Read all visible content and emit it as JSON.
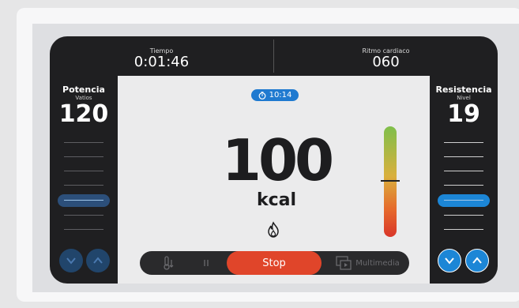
{
  "top": {
    "time_label": "Tiempo",
    "time_value": "0:01:46",
    "hr_label": "Ritmo cardiaco",
    "hr_value": "060"
  },
  "left_panel": {
    "title": "Potencia",
    "subtitle": "Vatios",
    "value": "120"
  },
  "right_panel": {
    "title": "Resistencia",
    "subtitle": "Nivel",
    "value": "19"
  },
  "center": {
    "timer": "10:14",
    "calories": "100",
    "unit": "kcal"
  },
  "bottom": {
    "stop_label": "Stop",
    "multimedia_label": "Multimedia"
  },
  "colors": {
    "accent_blue": "#1c86d6",
    "stop_red": "#e0452a",
    "dark": "#1f1f21"
  },
  "icons": [
    "timer-icon",
    "flame-icon",
    "temperature-icon",
    "pause-icon",
    "multimedia-icon",
    "chevron-down-icon",
    "chevron-up-icon"
  ]
}
